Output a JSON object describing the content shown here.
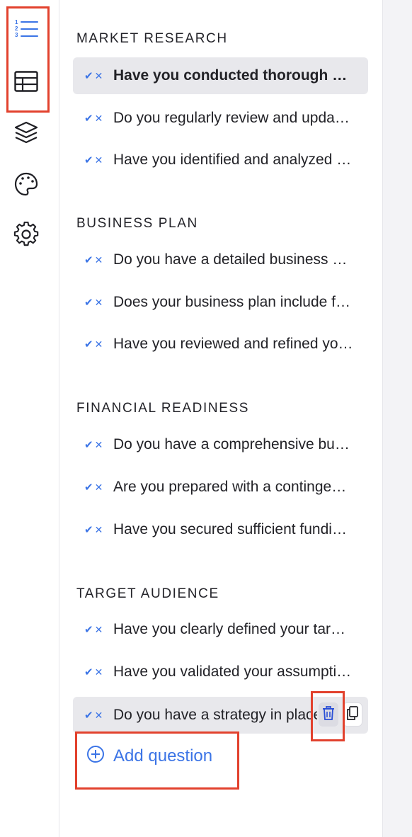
{
  "rail": {
    "items": [
      {
        "icon": "numbered-list-icon",
        "active": true
      },
      {
        "icon": "table-icon",
        "active": false
      },
      {
        "icon": "layers-icon",
        "active": false
      },
      {
        "icon": "palette-icon",
        "active": false
      },
      {
        "icon": "gear-icon",
        "active": false
      }
    ]
  },
  "colors": {
    "accent": "#3b74e6",
    "highlight": "#e2412d",
    "active_row": "#e8e8ec",
    "text": "#222227"
  },
  "sections": [
    {
      "title": "MARKET RESEARCH",
      "questions": [
        "Have you conducted thorough market research?",
        "Do you regularly review and update your market research?",
        "Have you identified and analyzed your competitors?"
      ]
    },
    {
      "title": "BUSINESS PLAN",
      "questions": [
        "Do you have a detailed business plan?",
        "Does your business plan include financial projections?",
        "Have you reviewed and refined your business plan?"
      ]
    },
    {
      "title": "FINANCIAL READINESS",
      "questions": [
        "Do you have a comprehensive budget?",
        "Are you prepared with a contingency fund?",
        "Have you secured sufficient funding?"
      ]
    },
    {
      "title": "TARGET AUDIENCE",
      "questions": [
        "Have you clearly defined your target audience?",
        "Have you validated your assumptions about your audience?",
        "Do you have a strategy in place"
      ]
    }
  ],
  "add_question": {
    "label": "Add question",
    "icon": "plus-circle-icon"
  },
  "row_actions": {
    "delete_icon": "trash-icon",
    "duplicate_icon": "copy-icon"
  }
}
